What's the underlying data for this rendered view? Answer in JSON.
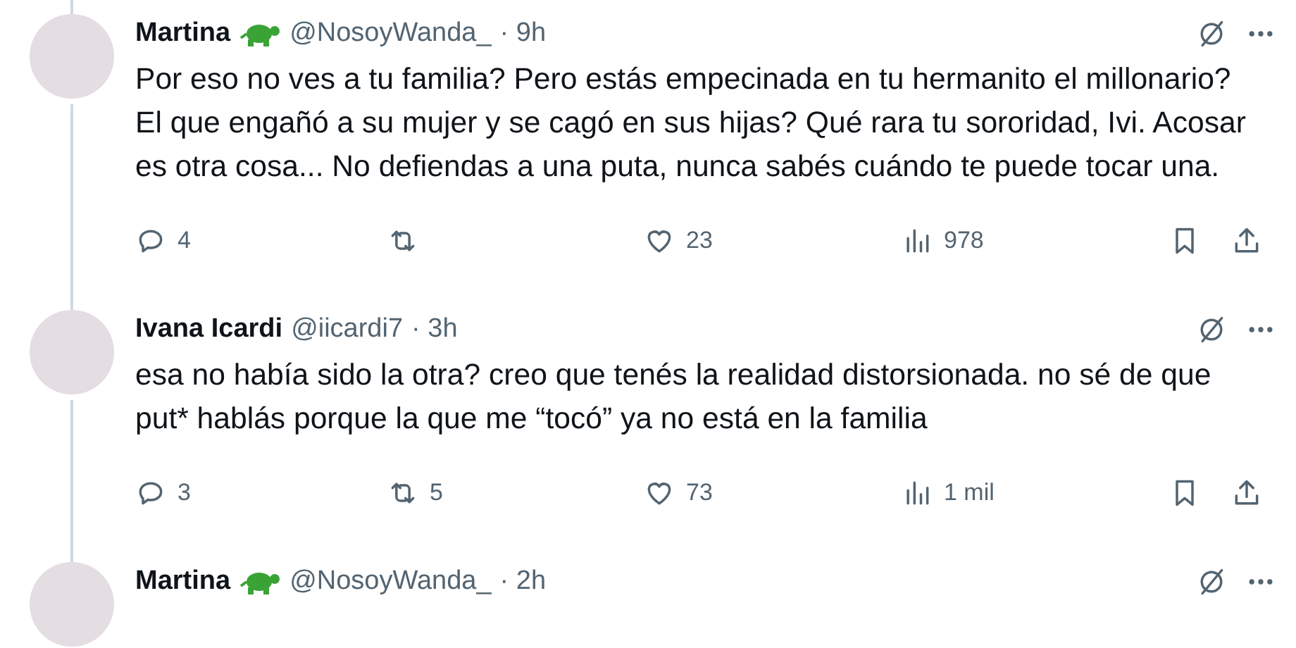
{
  "tweets": [
    {
      "name": "Martina",
      "badge": true,
      "handle": "@NosoyWanda_",
      "time": "· 9h",
      "text": "Por eso no ves a tu familia? Pero estás empecinada en tu hermanito el millonario? El que engañó a su mujer y se cagó en sus hijas? Qué rara tu sororidad, Ivi. Acosar es otra cosa... No defiendas a una puta, nunca sabés cuándo te puede tocar una.",
      "replies": "4",
      "likes": "23",
      "views": "978"
    },
    {
      "name": "Ivana Icardi",
      "badge": false,
      "handle": "@iicardi7",
      "time": "· 3h",
      "text": "esa no había sido la otra? creo que tenés la realidad distorsionada. no sé de que put* hablás porque la que me “tocó” ya no está en la familia",
      "replies": "3",
      "retweets": "5",
      "likes": "73",
      "views": "1 mil"
    },
    {
      "name": "Martina",
      "badge": true,
      "handle": "@NosoyWanda_",
      "time": "· 2h"
    }
  ]
}
